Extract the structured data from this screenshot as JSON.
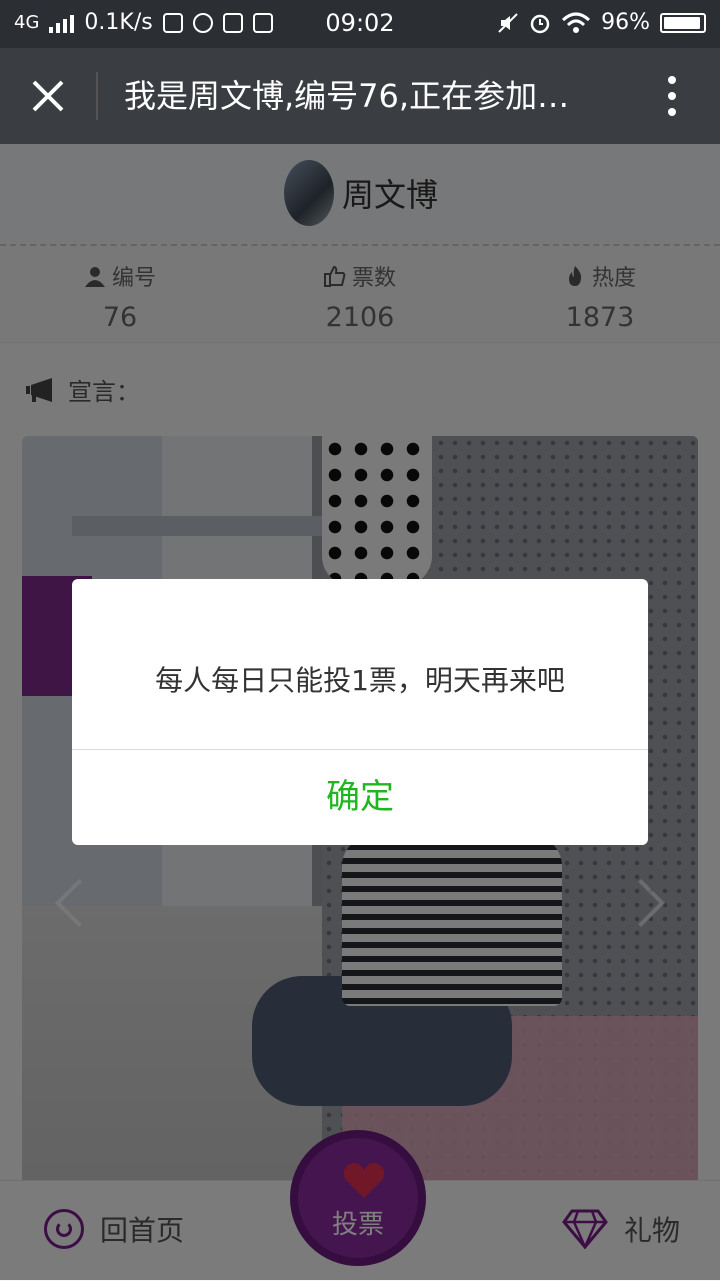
{
  "status_bar": {
    "network": "4G",
    "speed": "0.1K/s",
    "time": "09:02",
    "battery": "96%",
    "battery_level": 0.96
  },
  "nav": {
    "title": "我是周文博,编号76,正在参加…"
  },
  "profile": {
    "name": "周文博"
  },
  "stats": [
    {
      "label": "编号",
      "value": "76",
      "icon": "user-icon"
    },
    {
      "label": "票数",
      "value": "2106",
      "icon": "thumbs-up-icon"
    },
    {
      "label": "热度",
      "value": "1873",
      "icon": "fire-icon"
    }
  ],
  "declaration": {
    "label": "宣言："
  },
  "bottom": {
    "home_label": "回首页",
    "vote_label": "投票",
    "gift_label": "礼物"
  },
  "dialog": {
    "message": "每人每日只能投1票，明天再来吧",
    "confirm": "确定"
  },
  "colors": {
    "accent_purple": "#7a1a8a",
    "confirm_green": "#21b521"
  }
}
